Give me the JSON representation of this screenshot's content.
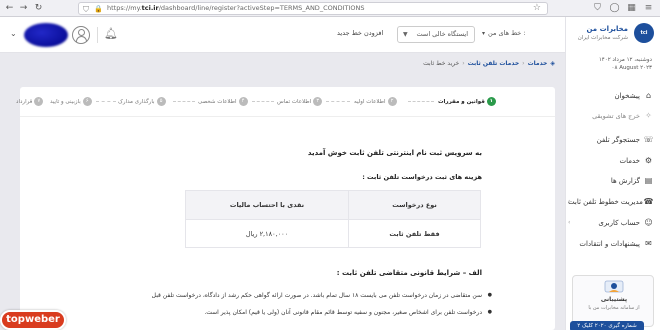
{
  "browser": {
    "url_prefix": "https://my.",
    "url_domain": "tci.ir",
    "url_suffix": "/dashboard/line/register?activeStep=TERMS_AND_CONDITIONS"
  },
  "header": {
    "phone_lines_label": "خط های من :",
    "phone_lines_select": "ایستگاه خالی است",
    "plan_link": "افزودن خط جدید"
  },
  "sidebar": {
    "brand_name": "مخابرات من",
    "brand_sub": "شرکت مخابرات ایران",
    "brand_logo": "tci",
    "date_fa": "دوشنبه، ۱۲ مرداد ۱۴۰۲",
    "date_en": "۰۸ August ۲۰۲۳",
    "items": [
      {
        "label": "پیشخوان",
        "icon": "dashboard-icon"
      },
      {
        "label": "خرج های تشویقی",
        "icon": "gift-icon",
        "sub": true
      },
      {
        "label": "جستجوگر تلفن",
        "icon": "search-phone-icon"
      },
      {
        "label": "خدمات",
        "icon": "services-icon"
      },
      {
        "label": "گزارش ها",
        "icon": "report-icon"
      },
      {
        "label": "مدیریت خطوط تلفن ثابت",
        "icon": "phone-lines-icon"
      },
      {
        "label": "حساب کاربری",
        "icon": "user-account-icon"
      },
      {
        "label": "پیشنهادات و انتقادات",
        "icon": "feedback-icon"
      }
    ],
    "support_title": "پشتیبانی",
    "support_sub": "از سامانه مخابرات من با",
    "support_button": "شماره گیری ۲۰۲۰ کلیک ۲"
  },
  "breadcrumb": {
    "home": "خدمات",
    "level1": "خدمات تلفن ثابت",
    "level2": "خرید خط ثابت"
  },
  "steps": [
    {
      "num": "۱",
      "label": "قوانین و مقررات",
      "active": true
    },
    {
      "num": "۲",
      "label": "اطلاعات اولیه"
    },
    {
      "num": "۳",
      "label": "اطلاعات تماس"
    },
    {
      "num": "۴",
      "label": "اطلاعات شخصی"
    },
    {
      "num": "۵",
      "label": "بارگذاری مدارک"
    },
    {
      "num": "۶",
      "label": "بازبینی و تایید"
    },
    {
      "num": "۷",
      "label": "قرارداد"
    }
  ],
  "content": {
    "welcome": "به سرویس ثبت نام اینترنتی تلفن ثابت خوش آمدید",
    "fees_title": "هزینه های ثبت درخواست تلفن ثابت :",
    "table": {
      "col1_header": "نوع درخواست",
      "col2_header": "نقدی با احتساب مالیات",
      "row_type": "فقط تلفن ثابت",
      "row_value": "۲,۱۸۰,۰۰۰ ریال"
    },
    "section_title": "الف – شرایط قانونی متقاضی تلفن ثابت :",
    "bullets": [
      "سن متقاضی در زمان درخواست تلفن می بایست ۱۸ سال تمام باشد. در صورت ارائه گواهی حکم رشد از دادگاه، درخواست تلفن قبل",
      "درخواست تلفن برای اشخاص صغیر، مجنون و سفیه توسط قائم مقام قانونی آنان (ولی یا قیم) امکان پذیر است."
    ]
  },
  "watermark": "topweber"
}
